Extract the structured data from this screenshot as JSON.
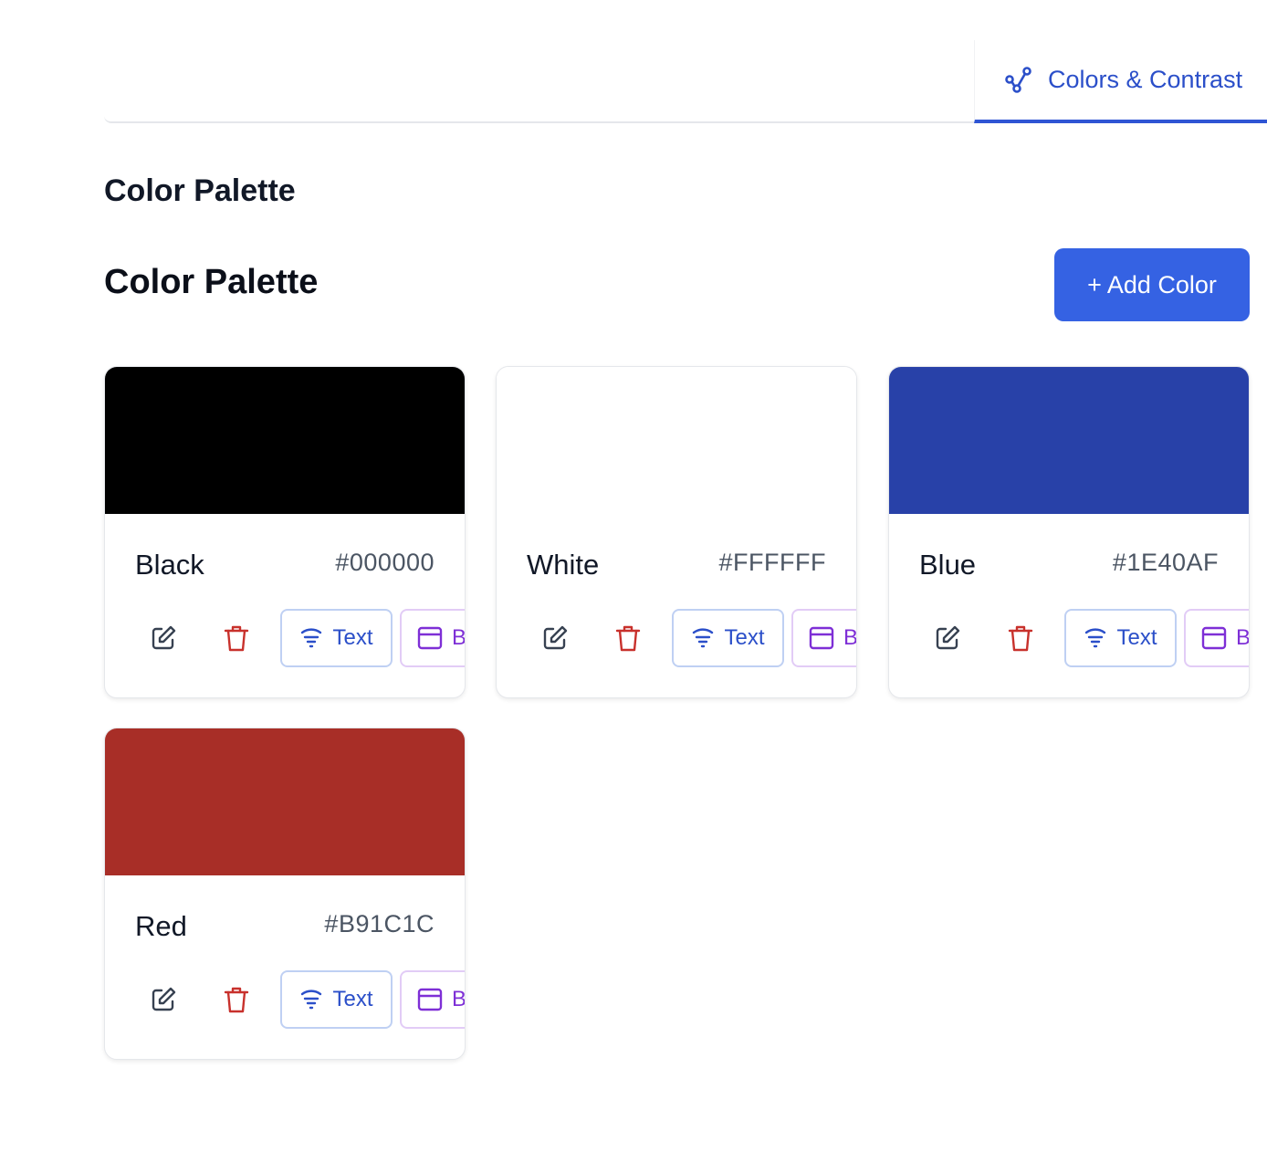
{
  "tabs": {
    "active_label": "Colors & Contrast",
    "active_icon": "share-nodes-icon"
  },
  "section_title": "Color Palette",
  "palette": {
    "title": "Color Palette",
    "add_button_label": "+ Add Color"
  },
  "colors": [
    {
      "name": "Black",
      "hex": "#000000",
      "text_chip": "Text",
      "bg_chip": "Background"
    },
    {
      "name": "White",
      "hex": "#FFFFFF",
      "text_chip": "Text",
      "bg_chip": "Background"
    },
    {
      "name": "Blue",
      "hex": "#1E40AF",
      "text_chip": "Text",
      "bg_chip": "Background"
    },
    {
      "name": "Red",
      "hex": "#B91C1C",
      "text_chip": "Text",
      "bg_chip": "Background"
    }
  ],
  "theme": {
    "accent": "#3562e3",
    "tab_text": "#2b4fc9",
    "delete_red": "#c8312c",
    "bg_chip_purple": "#7e2fd6"
  }
}
